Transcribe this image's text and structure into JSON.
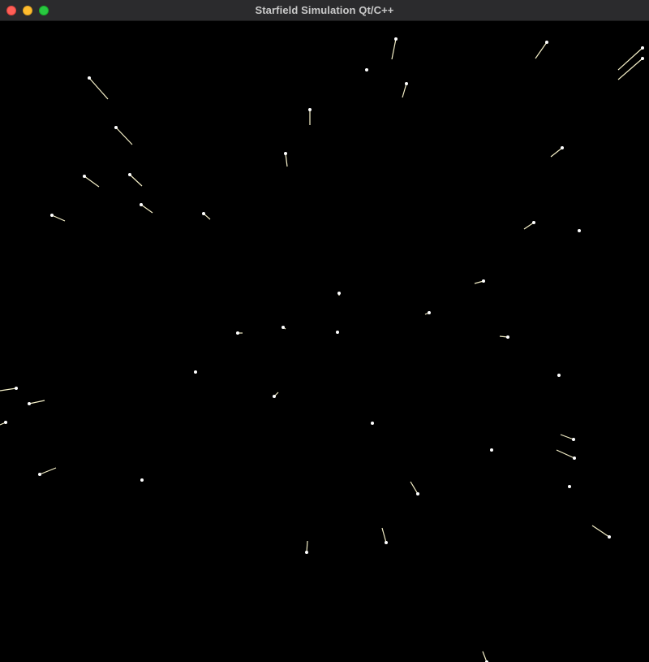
{
  "window": {
    "title": "Starfield Simulation Qt/C++"
  },
  "colors": {
    "background": "#000000",
    "star": "#ffffff",
    "trail": "#f5f0c8",
    "titlebar": "#2b2b2d"
  },
  "icons": {
    "close": "close-icon",
    "minimize": "minimize-icon",
    "maximize": "maximize-icon"
  }
}
